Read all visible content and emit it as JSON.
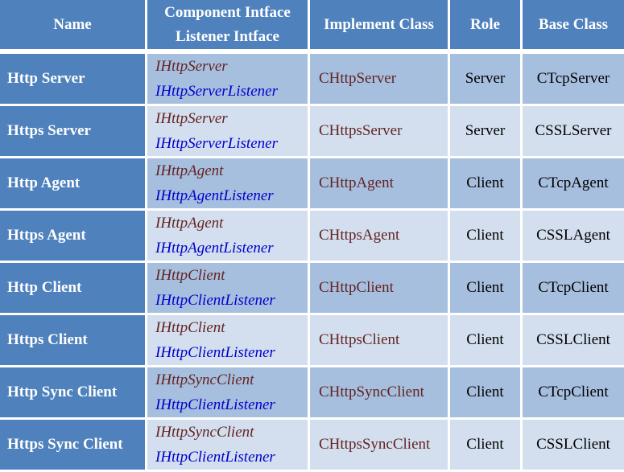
{
  "table": {
    "headers": {
      "name": "Name",
      "interface_line1": "Component Intface",
      "interface_line2": "Listener Intface",
      "implement": "Implement Class",
      "role": "Role",
      "base": "Base Class"
    },
    "colors": {
      "header_bg": "#4f81bd",
      "row_dark": "#a7bfde",
      "row_light": "#d3dfee",
      "component_text": "#632423",
      "listener_text": "#0000cc"
    },
    "rows": [
      {
        "name": "Http Server",
        "component": "IHttpServer",
        "listener": "IHttpServerListener",
        "implement": "CHttpServer",
        "role": "Server",
        "base": "CTcpServer"
      },
      {
        "name": "Https Server",
        "component": "IHttpServer",
        "listener": "IHttpServerListener",
        "implement": "CHttpsServer",
        "role": "Server",
        "base": "CSSLServer"
      },
      {
        "name": "Http Agent",
        "component": "IHttpAgent",
        "listener": "IHttpAgentListener",
        "implement": "CHttpAgent",
        "role": "Client",
        "base": "CTcpAgent"
      },
      {
        "name": "Https Agent",
        "component": "IHttpAgent",
        "listener": "IHttpAgentListener",
        "implement": "CHttpsAgent",
        "role": "Client",
        "base": "CSSLAgent"
      },
      {
        "name": "Http Client",
        "component": "IHttpClient",
        "listener": "IHttpClientListener",
        "implement": "CHttpClient",
        "role": "Client",
        "base": "CTcpClient"
      },
      {
        "name": "Https Client",
        "component": "IHttpClient",
        "listener": "IHttpClientListener",
        "implement": "CHttpsClient",
        "role": "Client",
        "base": "CSSLClient"
      },
      {
        "name": "Http Sync Client",
        "component": "IHttpSyncClient",
        "listener": "IHttpClientListener",
        "implement": "CHttpSyncClient",
        "role": "Client",
        "base": "CTcpClient"
      },
      {
        "name": "Https Sync Client",
        "component": "IHttpSyncClient",
        "listener": "IHttpClientListener",
        "implement": "CHttpsSyncClient",
        "role": "Client",
        "base": "CSSLClient"
      }
    ]
  }
}
